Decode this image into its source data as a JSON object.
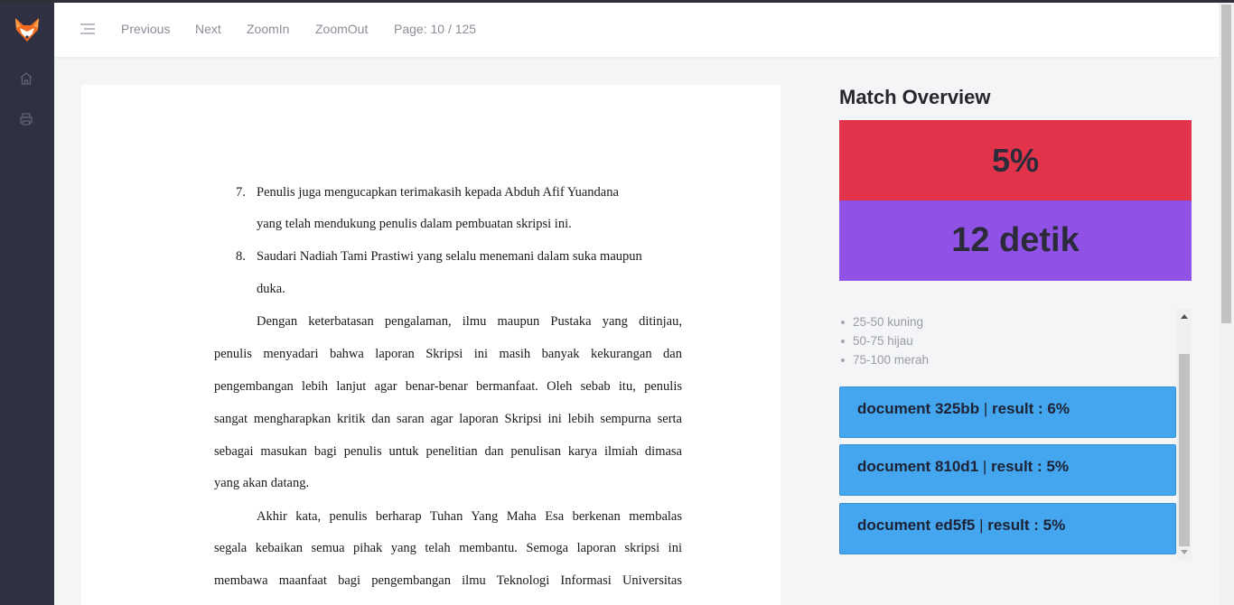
{
  "toolbar": {
    "previous_label": "Previous",
    "next_label": "Next",
    "zoomin_label": "ZoomIn",
    "zoomout_label": "ZoomOut",
    "page_label": "Page: 10 / 125"
  },
  "sidebar": {
    "logo_icon": "fox-logo-icon",
    "items": [
      {
        "icon": "home-icon"
      },
      {
        "icon": "printer-icon"
      }
    ]
  },
  "document": {
    "lines": [
      "7.",
      "Penulis juga mengucapkan terimakasih kepada Abduh Afif Yuandana",
      "yang telah mendukung penulis dalam pembuatan skripsi ini.",
      "8.",
      "Saudari Nadiah Tami Prastiwi yang selalu menemani dalam suka maupun",
      "duka.",
      "Dengan keterbatasan pengalaman, ilmu maupun Pustaka yang ditinjau,",
      "penulis menyadari bahwa laporan Skripsi ini masih banyak kekurangan dan",
      "pengembangan lebih lanjut agar benar-benar bermanfaat. Oleh sebab itu, penulis",
      "sangat mengharapkan kritik dan saran agar laporan Skripsi ini lebih sempurna serta",
      "sebagai masukan bagi penulis untuk penelitian dan penulisan karya ilmiah dimasa",
      "yang akan datang.",
      "Akhir kata, penulis berharap Tuhan Yang Maha Esa berkenan membalas",
      "segala kebaikan semua pihak yang telah membantu. Semoga laporan skripsi ini",
      "membawa maanfaat bagi pengembangan ilmu Teknologi Informasi Universitas"
    ]
  },
  "overview": {
    "title": "Match Overview",
    "percent": "5%",
    "time": "12 detik",
    "colors": {
      "percent_bg": "#e3334b",
      "time_bg": "#9051e6",
      "card_bg": "#44a6ef"
    },
    "legend": [
      "25-50 kuning",
      "50-75 hijau",
      "75-100 merah"
    ],
    "results": [
      {
        "doc": "document 325bb",
        "sep": " | ",
        "label": "result : ",
        "value": "6%"
      },
      {
        "doc": "document 810d1",
        "sep": " | ",
        "label": "result : ",
        "value": "5%"
      },
      {
        "doc": "document ed5f5",
        "sep": " | ",
        "label": "result : ",
        "value": "5%"
      }
    ]
  }
}
